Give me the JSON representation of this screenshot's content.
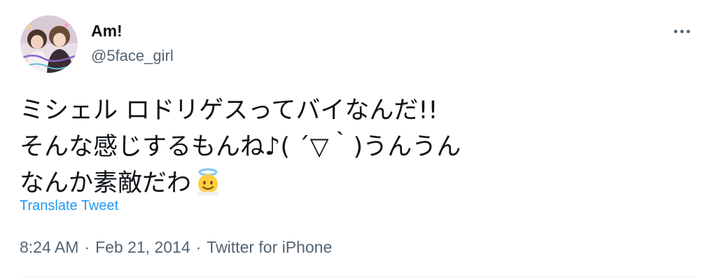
{
  "user": {
    "display_name": "Am!",
    "handle": "@5face_girl",
    "avatar_icon": "profile-photo"
  },
  "menu": {
    "icon": "more-horizontal-icon"
  },
  "tweet": {
    "lines": [
      "ミシェル ロドリゲスってバイなんだ!!",
      "そんな感じするもんね♪( ´▽｀)うんうん",
      "なんか素敵だわ"
    ],
    "emoji": "smiling-face-with-halo-icon"
  },
  "translate_label": "Translate Tweet",
  "meta": {
    "time": "8:24 AM",
    "separator": "·",
    "date": "Feb 21, 2014",
    "source": "Twitter for iPhone"
  },
  "colors": {
    "text": "#0f1419",
    "secondary": "#536471",
    "link": "#1d9bf0"
  }
}
